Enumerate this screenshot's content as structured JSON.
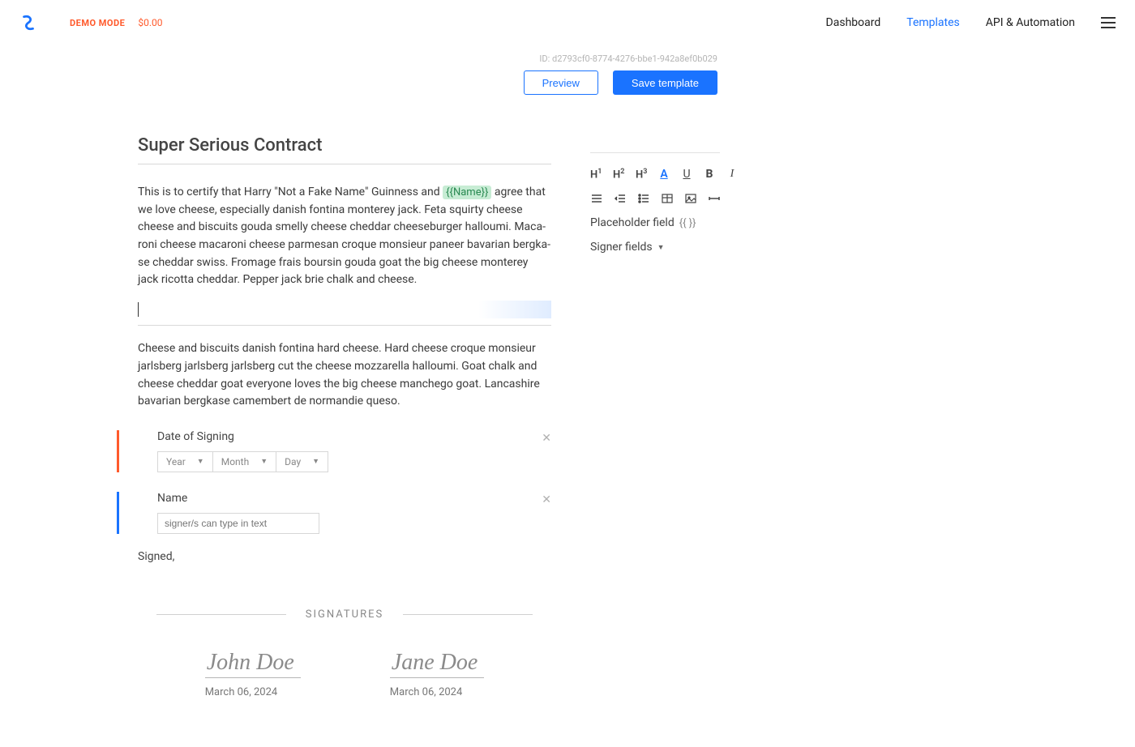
{
  "header": {
    "demo_badge": "DEMO MODE",
    "balance": "$0.00",
    "nav": {
      "dashboard": "Dashboard",
      "templates": "Templates",
      "api": "API & Automation"
    }
  },
  "template": {
    "id_label": "ID:",
    "id": "d2793cf0-8774-4276-bbe1-942a8ef0b029",
    "preview_btn": "Preview",
    "save_btn": "Save template"
  },
  "doc": {
    "title": "Super Serious Contract",
    "p1_a": "This is to certify that Harry \"Not a Fake Name\" Guinness and ",
    "p1_ph": "{{Name}}",
    "p1_b": " agree that we love cheese, especially danish fontina monterey jack. Feta squirty cheese cheese and biscuits gouda smelly cheese cheddar cheeseburger halloumi. Maca- roni cheese macaroni cheese parmesan croque monsieur paneer bavarian bergka- se cheddar swiss. Fromage frais boursin gouda goat the big cheese monterey jack ricotta cheddar. Pepper jack brie chalk and cheese.",
    "p2": "Cheese and biscuits danish fontina hard cheese. Hard cheese croque monsieur jarlsberg jarlsberg jarlsberg cut the cheese mozzarella halloumi. Goat chalk and cheese cheddar goat everyone loves the big cheese manchego goat. Lancashire bavarian bergkase camembert de normandie queso."
  },
  "fields": {
    "date_label": "Date of Signing",
    "year": "Year",
    "month": "Month",
    "day": "Day",
    "name_label": "Name",
    "name_placeholder": "signer/s can type in text",
    "signed": "Signed,"
  },
  "signatures": {
    "heading": "SIGNATURES",
    "sig1_name": "John Doe",
    "sig1_date": "March 06, 2024",
    "sig2_name": "Jane Doe",
    "sig2_date": "March 06, 2024"
  },
  "toolbar": {
    "h1": "H",
    "h2": "H",
    "h3": "H",
    "placeholder_label": "Placeholder field",
    "placeholder_icon": "{{ }}",
    "signer_label": "Signer fields"
  }
}
